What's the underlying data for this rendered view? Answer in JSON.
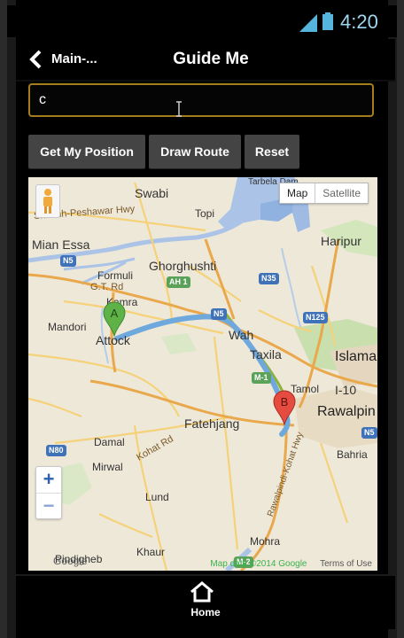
{
  "status_bar": {
    "time": "4:20",
    "icons": [
      "signal-icon",
      "battery-icon"
    ]
  },
  "action_bar": {
    "back_label": "Main-...",
    "title": "Guide Me",
    "back_icon": "chevron-left-icon"
  },
  "search": {
    "value": "c",
    "placeholder": ""
  },
  "buttons": {
    "get_position": "Get My Position",
    "draw_route": "Draw Route",
    "reset": "Reset"
  },
  "map": {
    "map_type": {
      "map": "Map",
      "satellite": "Satellite"
    },
    "zoom": {
      "in": "+",
      "out": "−"
    },
    "markers": [
      {
        "letter": "A",
        "label": "Attock",
        "color": "#5fb248"
      },
      {
        "letter": "B",
        "label": "Rawalpindi",
        "color": "#e54b3f"
      }
    ],
    "route_color": "#6fa8dc",
    "places": [
      {
        "name": "Swabi",
        "size": "mid"
      },
      {
        "name": "Topi",
        "size": "small"
      },
      {
        "name": "Tarbela Dam",
        "size": "small"
      },
      {
        "name": "Haripur",
        "size": "mid"
      },
      {
        "name": "Mian Essa",
        "size": "mid"
      },
      {
        "name": "Ghorghushti",
        "size": "mid"
      },
      {
        "name": "Formuli",
        "size": "small"
      },
      {
        "name": "Kamra",
        "size": "small"
      },
      {
        "name": "Mandori",
        "size": "small"
      },
      {
        "name": "Attock",
        "size": "mid"
      },
      {
        "name": "Wah",
        "size": "mid"
      },
      {
        "name": "Taxila",
        "size": "mid"
      },
      {
        "name": "Islamab",
        "size": "big"
      },
      {
        "name": "Tamol",
        "size": "small"
      },
      {
        "name": "I-10",
        "size": "mid"
      },
      {
        "name": "Rawalpin",
        "size": "big"
      },
      {
        "name": "Fatehjang",
        "size": "mid"
      },
      {
        "name": "Damal",
        "size": "small"
      },
      {
        "name": "Mirwal",
        "size": "small"
      },
      {
        "name": "Bahria",
        "size": "small"
      },
      {
        "name": "Lund",
        "size": "small"
      },
      {
        "name": "Khaur",
        "size": "small"
      },
      {
        "name": "Pindigheb",
        "size": "small"
      },
      {
        "name": "Mohra",
        "size": "small"
      }
    ],
    "roads": {
      "shachh": "Shachh-Peshawar Hwy",
      "gt_rd": "G.T. Rd",
      "kohat_rd": "Kohat Rd",
      "pindi_hwy": "Rawalpindi-Kohat Hwy"
    },
    "shields": [
      "N5",
      "AH 1",
      "N5",
      "N35",
      "N125",
      "M-1",
      "N80",
      "M-2",
      "N5"
    ],
    "attribution": {
      "data": "Map data ©2014 Google",
      "terms": "Terms of Use"
    },
    "watermark": "Google"
  },
  "bottom_bar": {
    "home_label": "Home"
  }
}
